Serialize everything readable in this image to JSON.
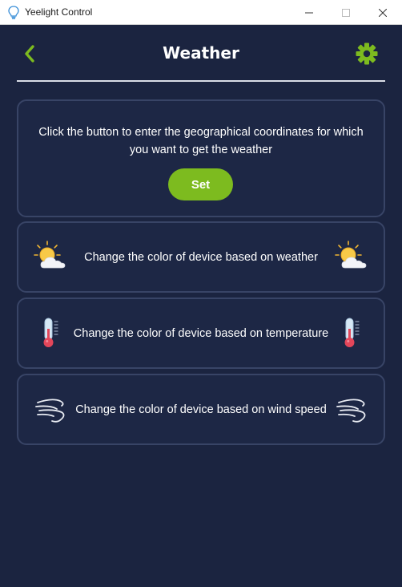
{
  "window": {
    "title": "Yeelight Control",
    "controls": [
      "minimize",
      "maximize",
      "close"
    ]
  },
  "header": {
    "title": "Weather",
    "back_icon": "chevron-left-icon",
    "settings_icon": "gear-icon"
  },
  "coordinates_card": {
    "text": "Click the button to enter the geographical coordinates for which you want to get the weather",
    "button_label": "Set"
  },
  "options": [
    {
      "label": "Change the color of device based on weather",
      "icon": "sun-cloud-icon"
    },
    {
      "label": "Change the color of device based on temperature",
      "icon": "thermometer-icon"
    },
    {
      "label": "Change the color of device based on wind speed",
      "icon": "wind-icon"
    }
  ],
  "colors": {
    "background": "#1b2440",
    "card_border": "#384466",
    "accent_green": "#7dbb1f",
    "text": "#ffffff"
  }
}
